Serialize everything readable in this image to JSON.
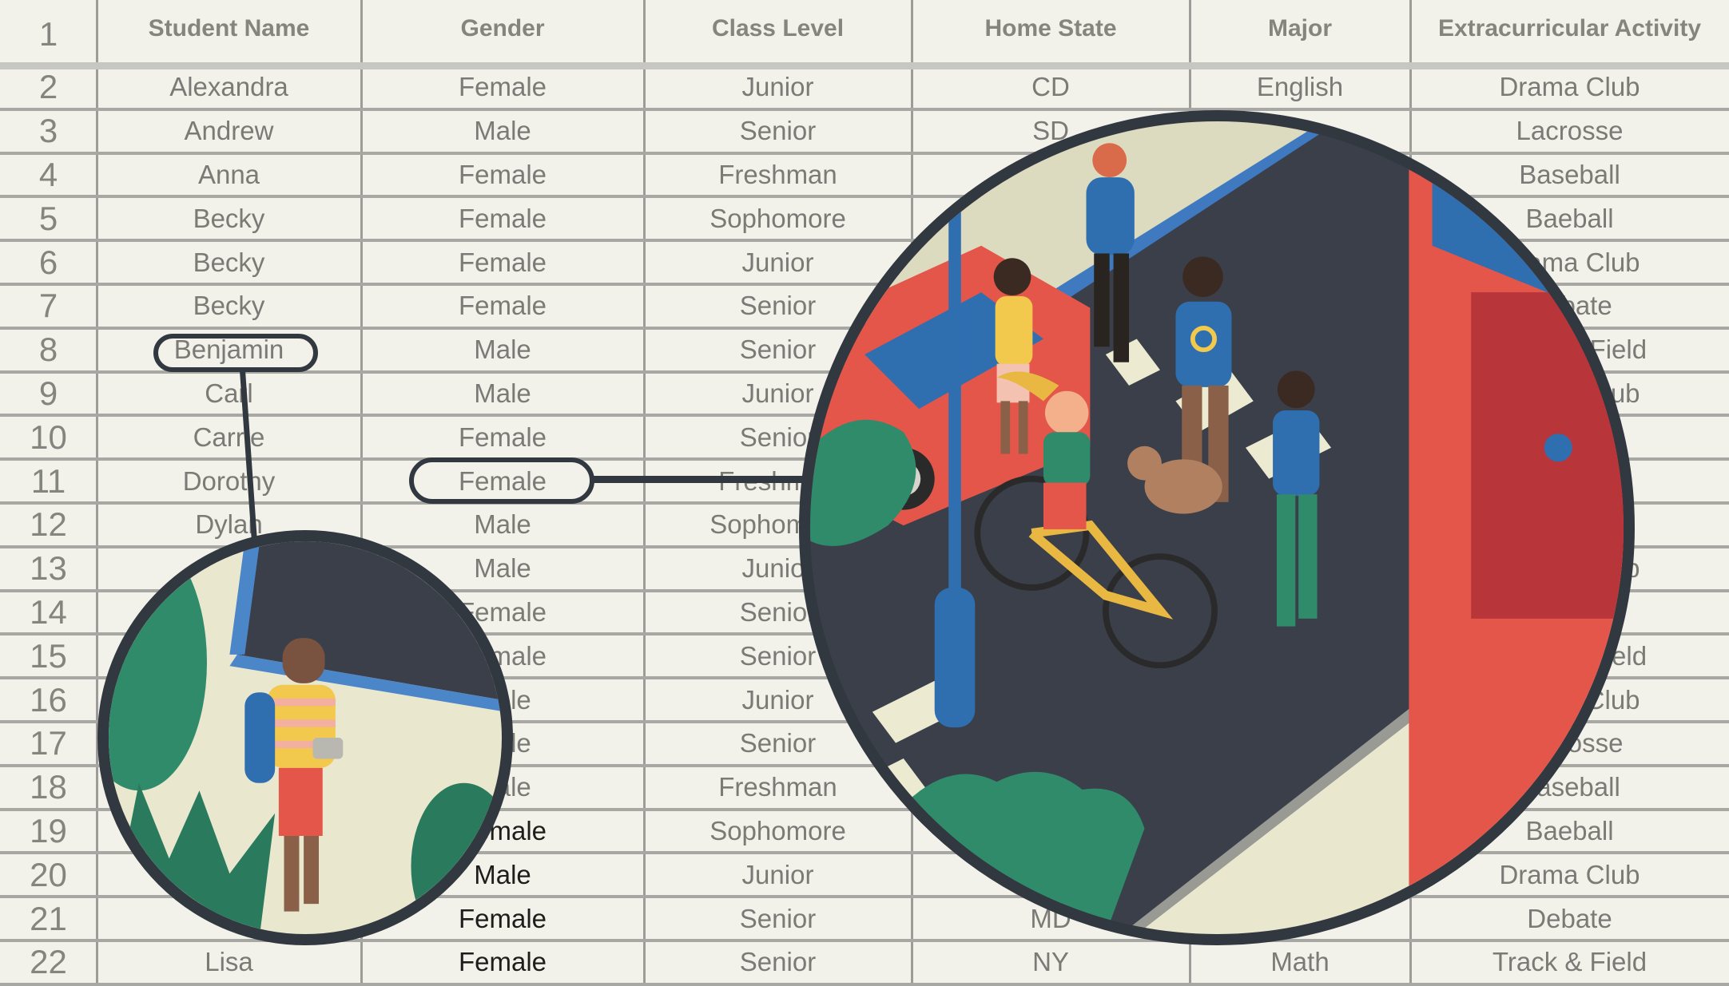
{
  "columns": [
    "Student Name",
    "Gender",
    "Class Level",
    "Home State",
    "Major",
    "Extracurricular Activity"
  ],
  "header_row_number": "1",
  "rows": [
    {
      "n": "2",
      "name": "Alexandra",
      "gender": "Female",
      "level": "Junior",
      "state": "CD",
      "major": "English",
      "activity": "Drama Club"
    },
    {
      "n": "3",
      "name": "Andrew",
      "gender": "Male",
      "level": "Senior",
      "state": "SD",
      "major": "",
      "activity": "Lacrosse"
    },
    {
      "n": "4",
      "name": "Anna",
      "gender": "Female",
      "level": "Freshman",
      "state": "",
      "major": "",
      "activity": "Baseball"
    },
    {
      "n": "5",
      "name": "Becky",
      "gender": "Female",
      "level": "Sophomore",
      "state": "",
      "major": "",
      "activity": "Baeball"
    },
    {
      "n": "6",
      "name": "Becky",
      "gender": "Female",
      "level": "Junior",
      "state": "",
      "major": "",
      "activity": "Drama Club"
    },
    {
      "n": "7",
      "name": "Becky",
      "gender": "Female",
      "level": "Senior",
      "state": "",
      "major": "",
      "activity": "Debate"
    },
    {
      "n": "8",
      "name": "Benjamin",
      "gender": "Male",
      "level": "Senior",
      "state": "",
      "major": "",
      "activity": "Track & Field"
    },
    {
      "n": "9",
      "name": "Carl",
      "gender": "Male",
      "level": "Junior",
      "state": "",
      "major": "",
      "activity": "Drama Club"
    },
    {
      "n": "10",
      "name": "Carrie",
      "gender": "Female",
      "level": "Senior",
      "state": "",
      "major": "",
      "activity": ""
    },
    {
      "n": "11",
      "name": "Dorothy",
      "gender": "Female",
      "level": "Freshman",
      "state": "",
      "major": "",
      "activity": ""
    },
    {
      "n": "12",
      "name": "Dylan",
      "gender": "Male",
      "level": "Sophomore",
      "state": "",
      "major": "",
      "activity": ""
    },
    {
      "n": "13",
      "name": "",
      "gender": "Male",
      "level": "Junior",
      "state": "",
      "major": "",
      "activity": "Drama Club"
    },
    {
      "n": "14",
      "name": "",
      "gender": "Female",
      "level": "Senior",
      "state": "",
      "major": "",
      "activity": ""
    },
    {
      "n": "15",
      "name": "",
      "gender": "Female",
      "level": "Senior",
      "state": "",
      "major": "",
      "activity": "Track & Field"
    },
    {
      "n": "16",
      "name": "",
      "gender": "Male",
      "level": "Junior",
      "state": "",
      "major": "",
      "activity": "Drama Club"
    },
    {
      "n": "17",
      "name": "",
      "gender": "Male",
      "level": "Senior",
      "state": "",
      "major": "",
      "activity": "Lacrosse"
    },
    {
      "n": "18",
      "name": "",
      "gender": "Male",
      "level": "Freshman",
      "state": "",
      "major": "",
      "activity": "Baseball"
    },
    {
      "n": "19",
      "name": "",
      "gender": "Female",
      "level": "Sophomore",
      "state": "",
      "major": "",
      "activity": "Baeball"
    },
    {
      "n": "20",
      "name": "",
      "gender": "Male",
      "level": "Junior",
      "state": "",
      "major": "",
      "activity": "Drama Club"
    },
    {
      "n": "21",
      "name": "",
      "gender": "Female",
      "level": "Senior",
      "state": "MD",
      "major": "",
      "activity": "Debate"
    },
    {
      "n": "22",
      "name": "Lisa",
      "gender": "Female",
      "level": "Senior",
      "state": "NY",
      "major": "Math",
      "activity": "Track & Field"
    }
  ],
  "highlights": [
    {
      "label": "Benjamin",
      "row": "8",
      "column": "Student Name"
    },
    {
      "label": "Female",
      "row": "11",
      "column": "Gender"
    }
  ],
  "illustrations": {
    "small_lens": "student-with-camera-walking-on-sidewalk",
    "large_lens": "busy-street-scene-with-car-cyclist-pedestrians-dog"
  },
  "colors": {
    "background": "#f3f2ea",
    "gridline": "#9c9c98",
    "text": "#7a7a76",
    "lens_border": "#323840",
    "street": "#3a3f4a",
    "car_red": "#e4564a",
    "accent_blue": "#2f6fb0",
    "foliage_green": "#2f8b6a",
    "accent_yellow": "#e8b842"
  }
}
